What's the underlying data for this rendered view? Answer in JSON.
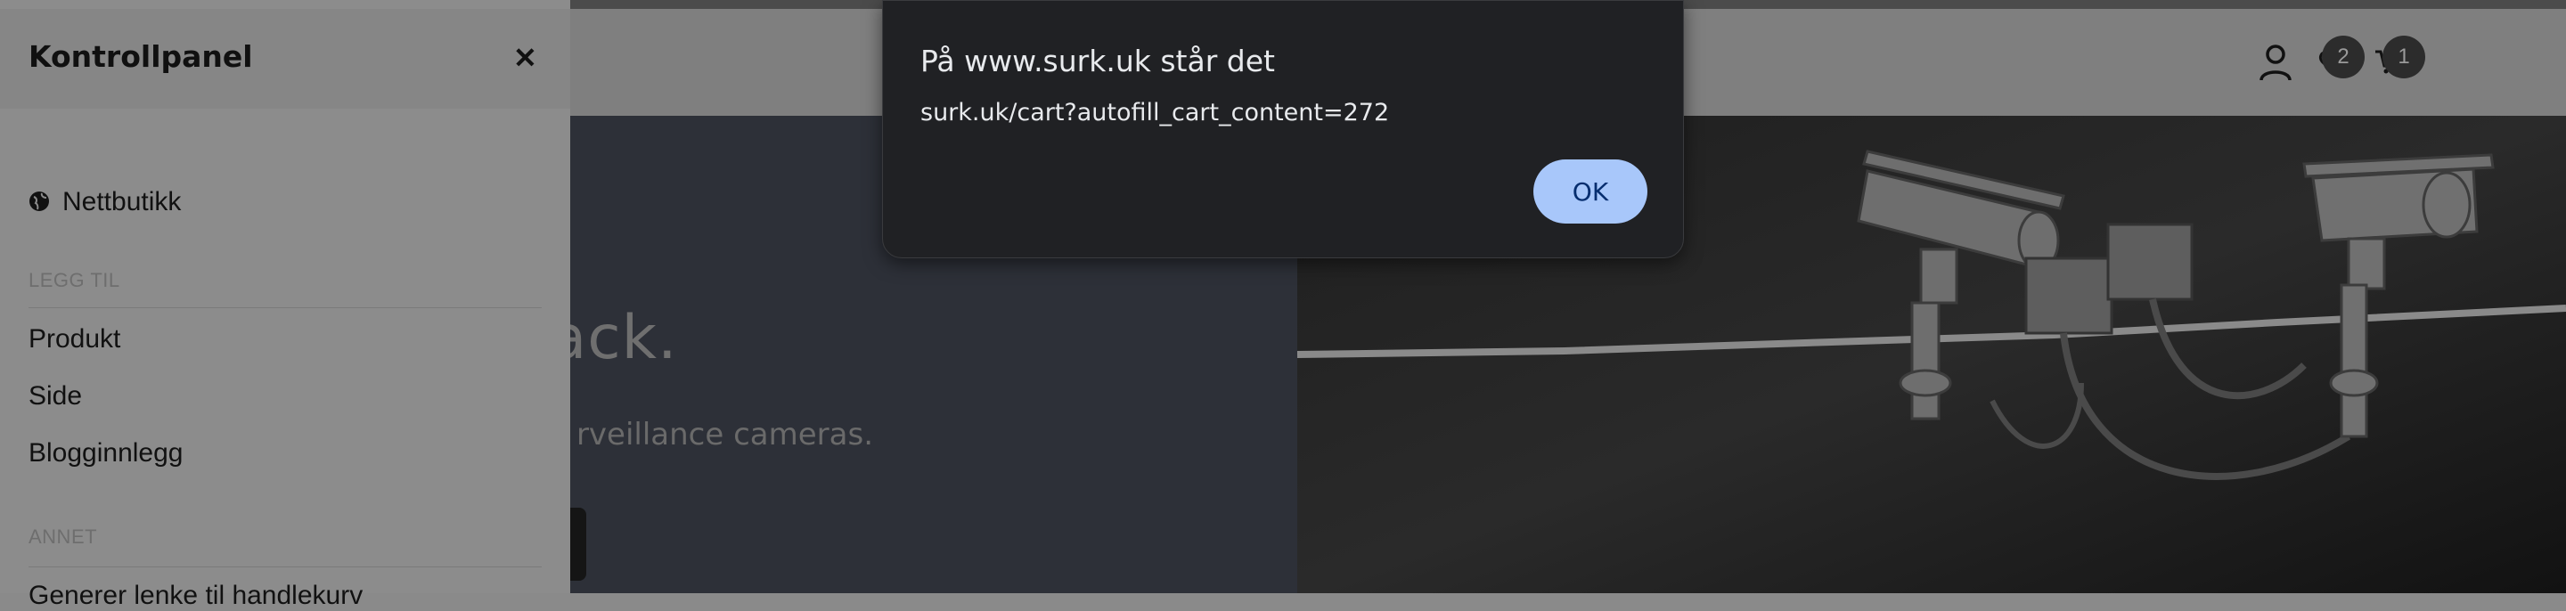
{
  "dialog": {
    "title": "På www.surk.uk står det",
    "message": "surk.uk/cart?autofill_cart_content=272",
    "ok_label": "OK"
  },
  "sidebar": {
    "title": "Kontrollpanel",
    "close_icon": "close-icon",
    "store_item": {
      "icon": "globe-icon",
      "label": "Nettbutikk"
    },
    "section_add": "LEGG TIL",
    "add_items": [
      "Produkt",
      "Side",
      "Blogginnlegg"
    ],
    "section_other": "ANNET",
    "other_items": [
      "Generer lenke til handlekurv"
    ]
  },
  "hero": {
    "title_fragment": "track.",
    "subtitle_fragment": "rveillance cameras."
  },
  "header": {
    "user_icon": "user-icon",
    "wishlist_icon": "heart-icon",
    "wishlist_count": "2",
    "cart_icon": "cart-icon",
    "cart_count": "1"
  }
}
